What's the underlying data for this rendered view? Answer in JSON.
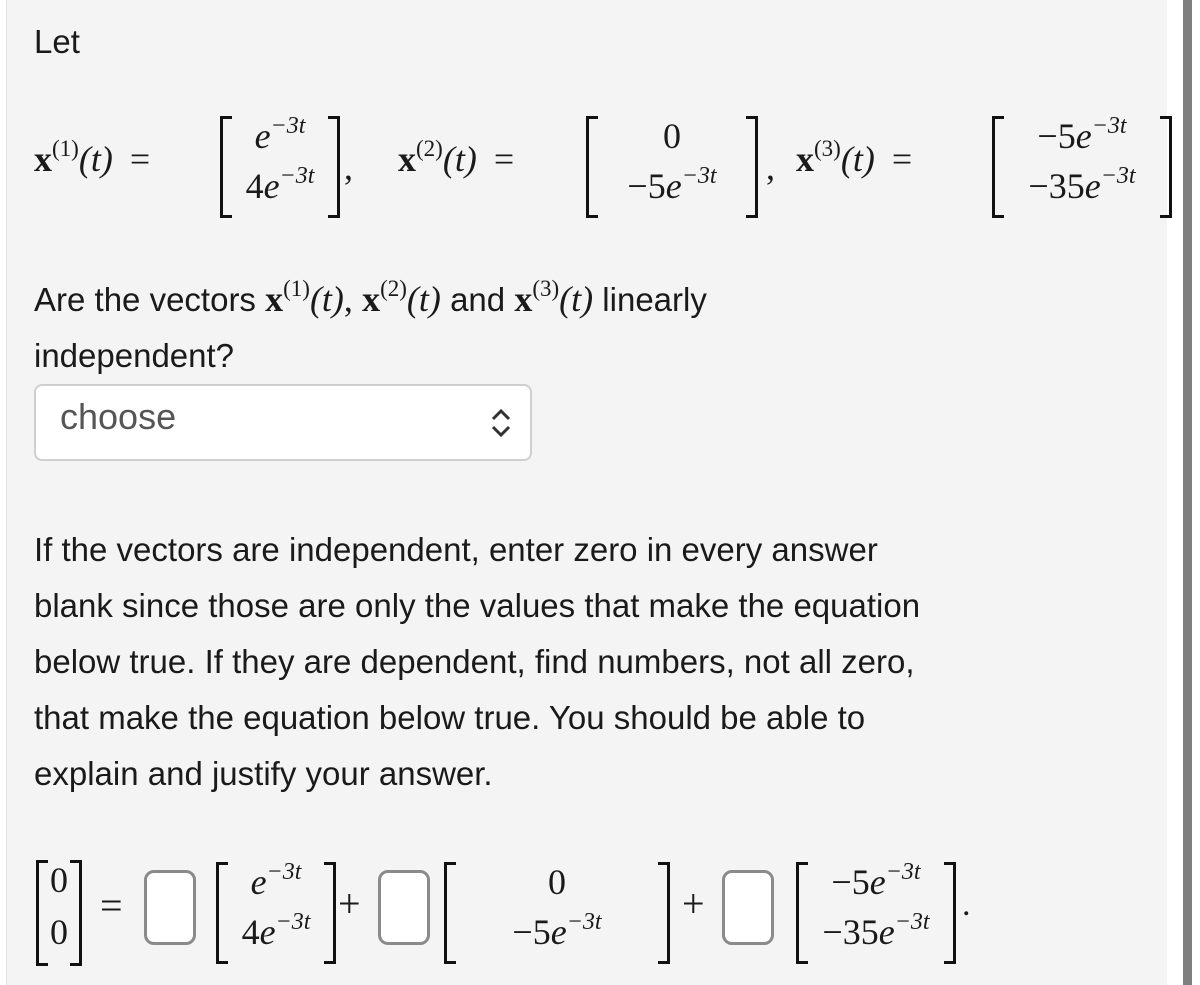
{
  "intro": "Let",
  "vectors": [
    {
      "name": "x",
      "index": "(1)",
      "arg": "(t)",
      "top": {
        "coef": "",
        "base": "e",
        "exp": "−3t"
      },
      "bot": {
        "coef": "4",
        "base": "e",
        "exp": "−3t"
      }
    },
    {
      "name": "x",
      "index": "(2)",
      "arg": "(t)",
      "top": {
        "coef": "0",
        "base": "",
        "exp": ""
      },
      "bot": {
        "coef": "−5",
        "base": "e",
        "exp": "−3t"
      }
    },
    {
      "name": "x",
      "index": "(3)",
      "arg": "(t)",
      "top": {
        "coef": "−5",
        "base": "e",
        "exp": "−3t"
      },
      "bot": {
        "coef": "−35",
        "base": "e",
        "exp": "−3t"
      }
    }
  ],
  "symbols": {
    "equals": "=",
    "comma": ",",
    "plus": "+",
    "period": "."
  },
  "question": {
    "prefix": "Are the vectors",
    "sep": ",",
    "and": "and",
    "suffix": "linearly",
    "line2": "independent?"
  },
  "select": {
    "value": "choose",
    "options_visible": [
      "choose"
    ]
  },
  "instructions": [
    "If the vectors are independent, enter zero in every answer",
    "blank since those are only the values that make the equation",
    "below true. If they are dependent, find numbers, not all zero,",
    "that make the equation below true. You should be able to",
    "explain and justify your answer."
  ],
  "equation": {
    "lhs": {
      "top": "0",
      "bot": "0"
    },
    "blanks": [
      {
        "value": "",
        "placeholder": ""
      },
      {
        "value": "",
        "placeholder": ""
      },
      {
        "value": "",
        "placeholder": ""
      }
    ]
  },
  "colors": {
    "panel": "#f4f4f4",
    "scrollbar": "#7f7f7f",
    "border": "#cfcfcf"
  }
}
